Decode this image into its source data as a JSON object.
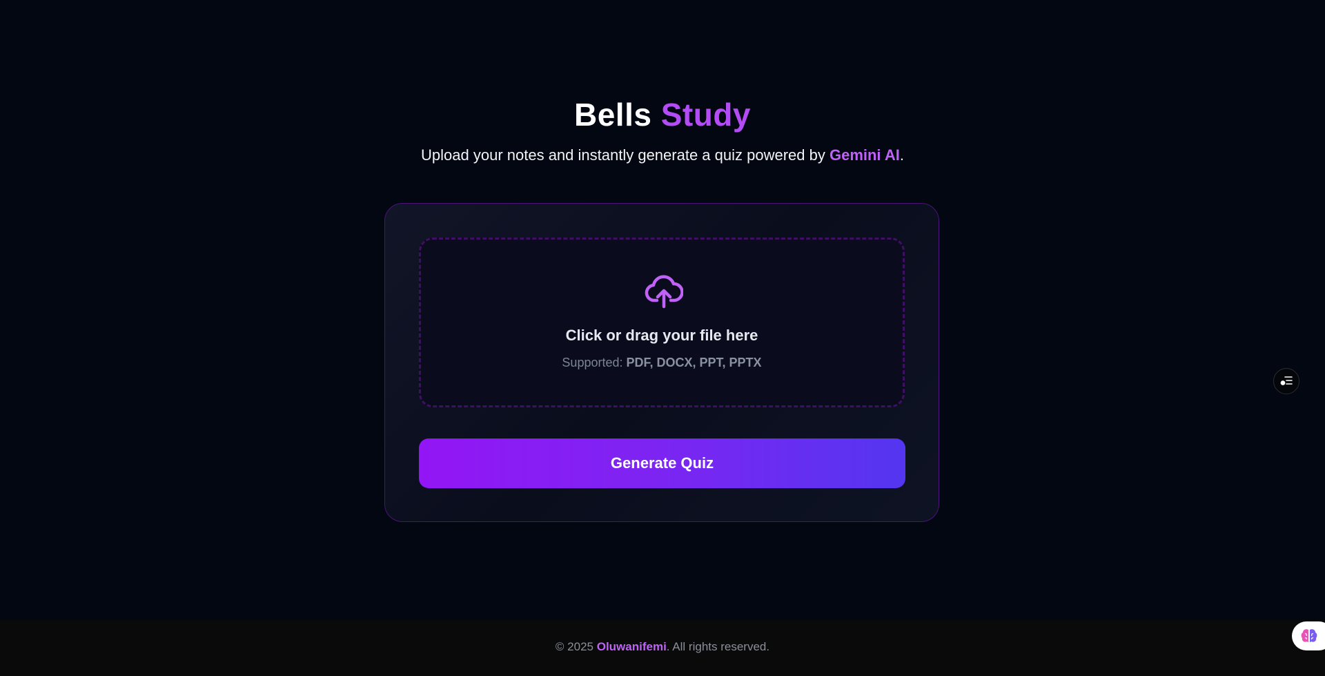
{
  "header": {
    "title_part1": "Bells",
    "title_part2": "Study",
    "subtitle_before": "Upload your notes and instantly generate a quiz powered by ",
    "subtitle_highlight": "Gemini AI",
    "subtitle_after": "."
  },
  "upload": {
    "icon": "cloud-upload-icon",
    "title": "Click or drag your file here",
    "supported_label": "Supported:",
    "supported_formats": "PDF, DOCX, PPT, PPTX"
  },
  "actions": {
    "generate_label": "Generate Quiz"
  },
  "side_tool": {
    "icon": "settings-list-icon"
  },
  "footer": {
    "copyright": "© 2025",
    "name": "Oluwanifemi",
    "rights": ". All rights reserved."
  },
  "widget": {
    "icon": "brain-icon"
  },
  "colors": {
    "background": "#030712",
    "accent": "#b44cf5",
    "button_start": "#9316f5",
    "button_end": "#5436f0",
    "card_border": "#4a1478"
  }
}
